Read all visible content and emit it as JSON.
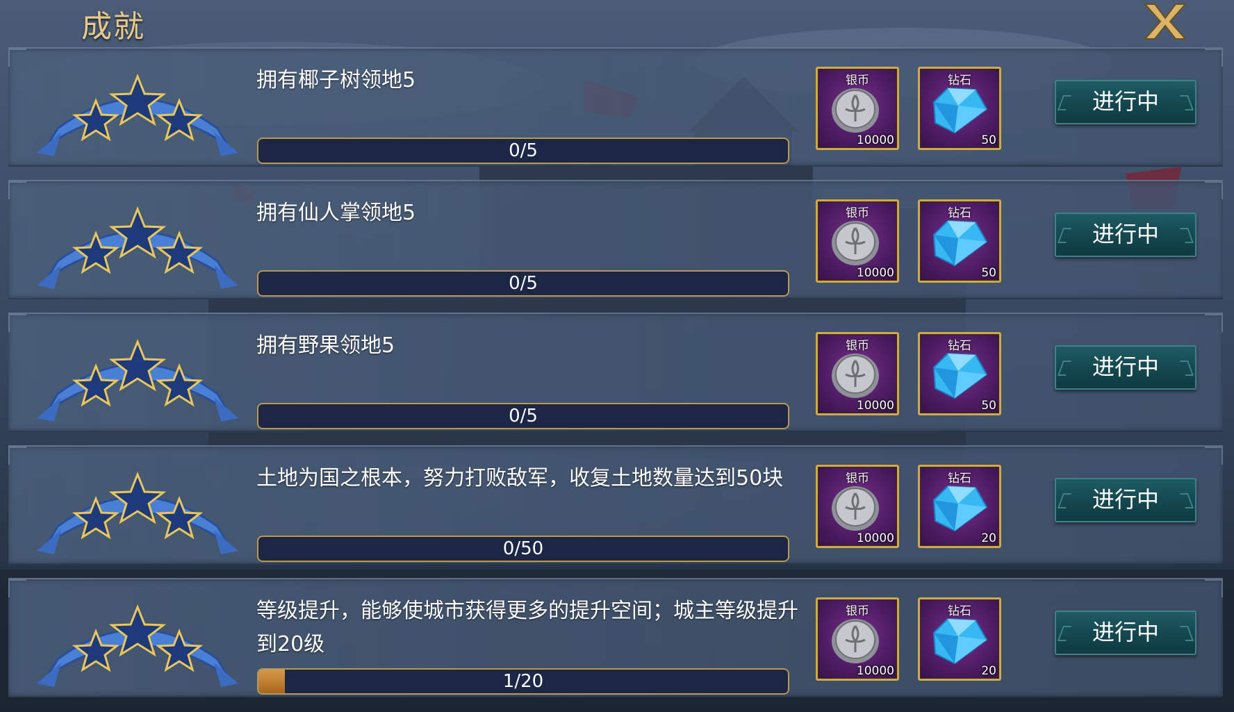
{
  "header": {
    "title": "成就",
    "close_label": "X"
  },
  "achievements": [
    {
      "description": "拥有椰子树领地5",
      "progress_text": "0/5",
      "progress_fraction": 0.0,
      "rewards": [
        {
          "label": "银币",
          "amount": "10000",
          "icon": "silver-coin-icon"
        },
        {
          "label": "钻石",
          "amount": "50",
          "icon": "diamond-icon"
        }
      ],
      "status": "进行中"
    },
    {
      "description": "拥有仙人掌领地5",
      "progress_text": "0/5",
      "progress_fraction": 0.0,
      "rewards": [
        {
          "label": "银币",
          "amount": "10000",
          "icon": "silver-coin-icon"
        },
        {
          "label": "钻石",
          "amount": "50",
          "icon": "diamond-icon"
        }
      ],
      "status": "进行中"
    },
    {
      "description": "拥有野果领地5",
      "progress_text": "0/5",
      "progress_fraction": 0.0,
      "rewards": [
        {
          "label": "银币",
          "amount": "10000",
          "icon": "silver-coin-icon"
        },
        {
          "label": "钻石",
          "amount": "50",
          "icon": "diamond-icon"
        }
      ],
      "status": "进行中"
    },
    {
      "description": "土地为国之根本，努力打败敌军，收复土地数量达到50块",
      "progress_text": "0/50",
      "progress_fraction": 0.0,
      "rewards": [
        {
          "label": "银币",
          "amount": "10000",
          "icon": "silver-coin-icon"
        },
        {
          "label": "钻石",
          "amount": "20",
          "icon": "diamond-icon"
        }
      ],
      "status": "进行中"
    },
    {
      "description": "等级提升，能够使城市获得更多的提升空间；城主等级提升到20级",
      "progress_text": "1/20",
      "progress_fraction": 0.05,
      "rewards": [
        {
          "label": "银币",
          "amount": "10000",
          "icon": "silver-coin-icon"
        },
        {
          "label": "钻石",
          "amount": "20",
          "icon": "diamond-icon"
        }
      ],
      "status": "进行中"
    }
  ]
}
